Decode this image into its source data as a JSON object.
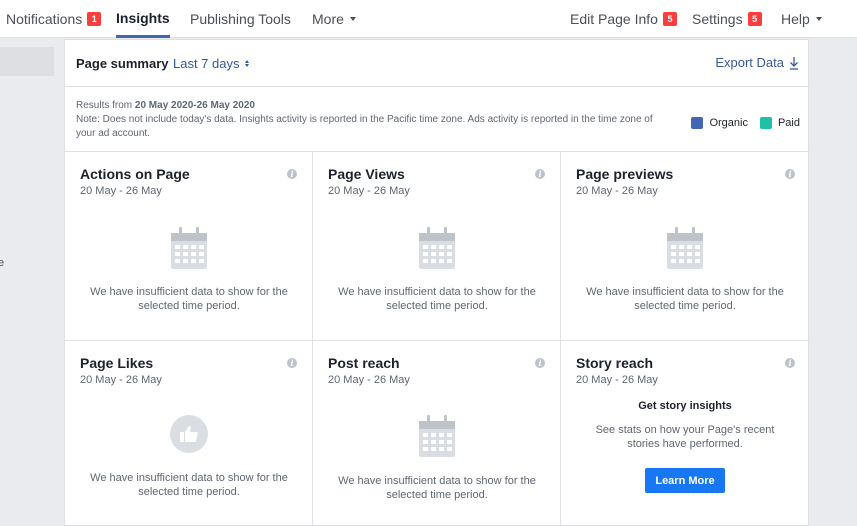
{
  "nav": {
    "notifications": {
      "label": "Notifications",
      "badge": "1"
    },
    "insights": {
      "label": "Insights"
    },
    "publishing_tools": {
      "label": "Publishing Tools"
    },
    "more": {
      "label": "More"
    },
    "edit_page_info": {
      "label": "Edit Page Info",
      "badge": "5"
    },
    "settings": {
      "label": "Settings",
      "badge": "5"
    },
    "help": {
      "label": "Help"
    }
  },
  "sidebar": {
    "fragment": "e"
  },
  "summary": {
    "title": "Page summary",
    "range": "Last 7 days",
    "export_label": "Export Data"
  },
  "info": {
    "results_prefix": "Results from ",
    "results_range": "20 May 2020-26 May 2020",
    "note": "Note: Does not include today's data. Insights activity is reported in the Pacific time zone. Ads activity is reported in the time zone of your ad account."
  },
  "legend": [
    {
      "label": "Organic",
      "color": "#4267b2"
    },
    {
      "label": "Paid",
      "color": "#1ec1a6"
    }
  ],
  "empty_message": "We have insufficient data to show for the selected time period.",
  "cards": [
    {
      "title": "Actions on Page",
      "date": "20 May - 26 May",
      "icon": "calendar-icon"
    },
    {
      "title": "Page Views",
      "date": "20 May - 26 May",
      "icon": "calendar-icon"
    },
    {
      "title": "Page previews",
      "date": "20 May - 26 May",
      "icon": "calendar-icon"
    },
    {
      "title": "Page Likes",
      "date": "20 May - 26 May",
      "icon": "thumbs-up-icon"
    },
    {
      "title": "Post reach",
      "date": "20 May - 26 May",
      "icon": "calendar-icon"
    },
    {
      "title": "Story reach",
      "date": "20 May - 26 May",
      "icon": "none"
    }
  ],
  "story": {
    "heading": "Get story insights",
    "text": "See stats on how your Page's recent stories have performed.",
    "button": "Learn More"
  },
  "colors": {
    "accent": "#4267b2",
    "link": "#385898",
    "badge": "#fa3e3e",
    "button": "#1877f2"
  }
}
